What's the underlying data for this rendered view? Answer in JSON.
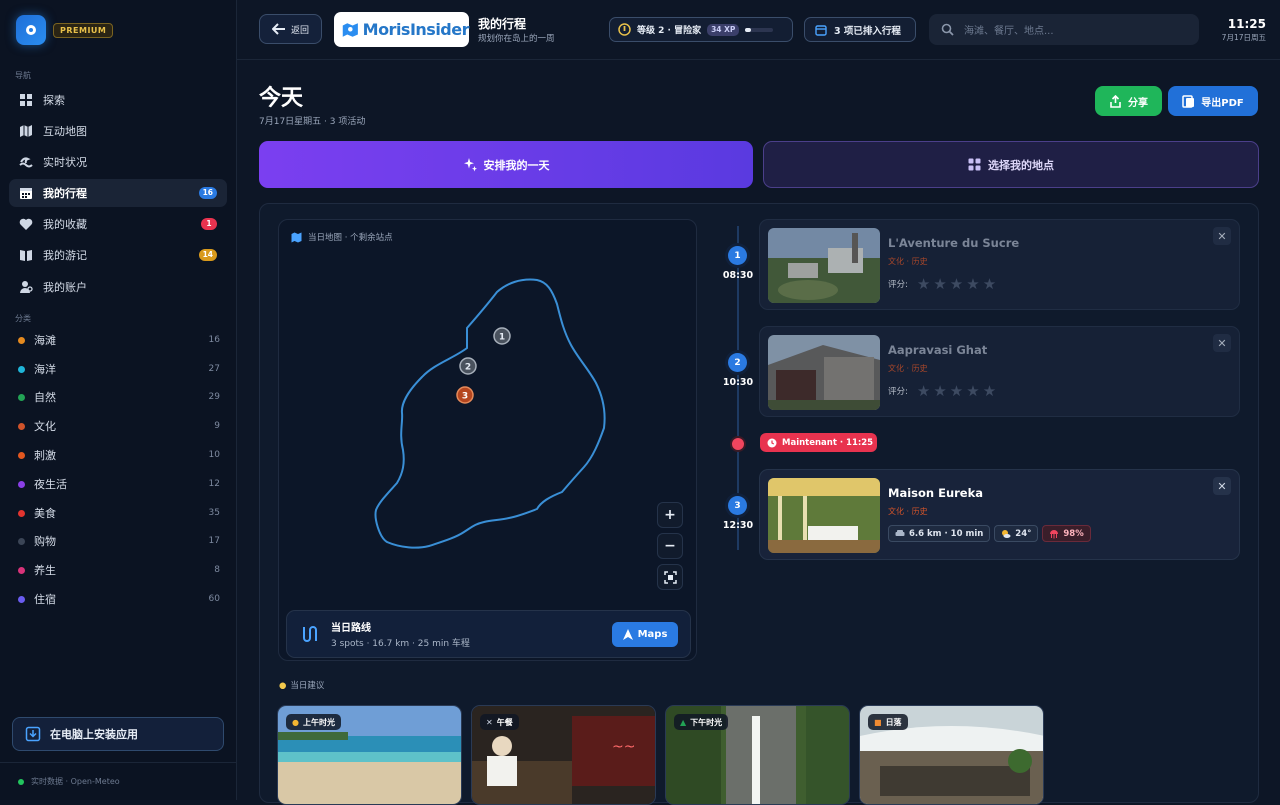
{
  "sidebar": {
    "premium_label": "PREMIUM",
    "nav_section": "导航",
    "nav": [
      {
        "label": "探索",
        "icon": "grid-icon"
      },
      {
        "label": "互动地图",
        "icon": "map-icon"
      },
      {
        "label": "实时状况",
        "icon": "waves-icon"
      },
      {
        "label": "我的行程",
        "icon": "calendar-icon",
        "badge": "16",
        "badge_color": "#2a7ae2",
        "active": true
      },
      {
        "label": "我的收藏",
        "icon": "heart-icon",
        "badge": "1",
        "badge_color": "#e8334f"
      },
      {
        "label": "我的游记",
        "icon": "book-icon",
        "badge": "14",
        "badge_color": "#d99a1c"
      },
      {
        "label": "我的账户",
        "icon": "user-icon"
      }
    ],
    "category_section": "分类",
    "categories": [
      {
        "label": "海滩",
        "count": "16",
        "color": "#e58a1f"
      },
      {
        "label": "海洋",
        "count": "27",
        "color": "#1fb5d9"
      },
      {
        "label": "自然",
        "count": "29",
        "color": "#22a355"
      },
      {
        "label": "文化",
        "count": "9",
        "color": "#d0532a"
      },
      {
        "label": "刺激",
        "count": "10",
        "color": "#e3571f"
      },
      {
        "label": "夜生活",
        "count": "12",
        "color": "#8a3fe6"
      },
      {
        "label": "美食",
        "count": "35",
        "color": "#e3342f"
      },
      {
        "label": "购物",
        "count": "17",
        "color": "#3b4556"
      },
      {
        "label": "养生",
        "count": "8",
        "color": "#d9337a"
      },
      {
        "label": "住宿",
        "count": "60",
        "color": "#6a5cf0"
      }
    ],
    "install_label": "在电脑上安装应用",
    "footer_text": "实时数据 · Open-Meteo"
  },
  "topbar": {
    "back_label": "返回",
    "brand_name": "MorisInsider",
    "title": "我的行程",
    "subtitle": "规划你在岛上的一周",
    "level_text": "等级 2 · 冒险家",
    "xp_text": "34 XP",
    "xp_progress": 0.2,
    "planned_text": "3 项已排入行程",
    "search_placeholder": "海滩、餐厅、地点...",
    "time": "11:25",
    "date": "7月17日周五"
  },
  "day": {
    "title": "今天",
    "subtitle": "7月17日星期五 · 3 项活动",
    "share_label": "分享",
    "pdf_label": "导出PDF",
    "plan_label": "安排我的一天",
    "choose_label": "选择我的地点"
  },
  "map": {
    "label": "当日地图 · 个剩余站点",
    "pins": [
      "1",
      "2",
      "3"
    ],
    "route_title": "当日路线",
    "route_sub": "3 spots · 16.7 km · 25 min 车程",
    "maps_label": "Maps"
  },
  "timeline": {
    "now_label": "Maintenant · 11:25",
    "rating_label": "评分:",
    "items": [
      {
        "num": "1",
        "time": "08:30",
        "name": "L'Aventure du Sucre",
        "category": "文化 · 历史",
        "rating": 0
      },
      {
        "num": "2",
        "time": "10:30",
        "name": "Aapravasi Ghat",
        "category": "文化 · 历史",
        "rating": 0
      },
      {
        "num": "3",
        "time": "12:30",
        "name": "Maison Eureka",
        "category": "文化 · 历史",
        "distance": "6.6 km · 10 min",
        "weather": "24°",
        "humidity": "98%"
      }
    ]
  },
  "suggestions": {
    "label": "当日建议",
    "cards": [
      {
        "tag": "上午时光",
        "icon": "sun-icon"
      },
      {
        "tag": "午餐",
        "icon": "fork-icon"
      },
      {
        "tag": "下午时光",
        "icon": "tree-icon"
      },
      {
        "tag": "日落",
        "icon": "sunset-icon"
      }
    ]
  }
}
